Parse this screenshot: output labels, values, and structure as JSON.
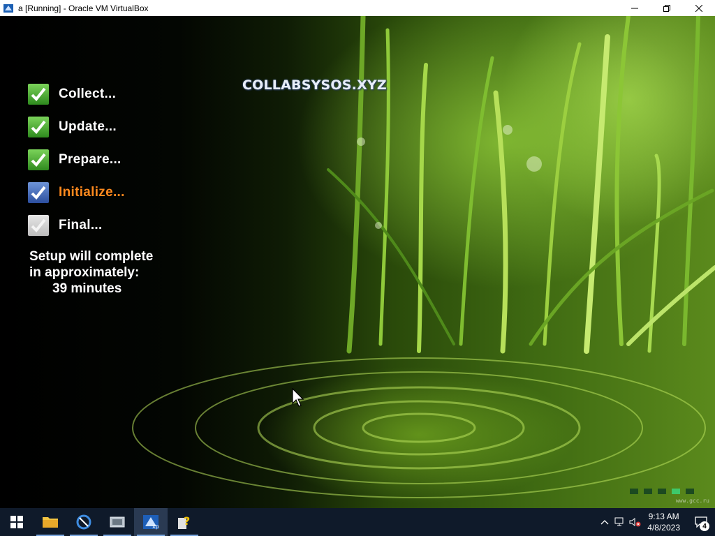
{
  "window": {
    "title": "a [Running] - Oracle VM VirtualBox",
    "controls": [
      "minimize",
      "restore",
      "close"
    ]
  },
  "setup": {
    "steps": [
      {
        "label": "Collect...",
        "state": "done"
      },
      {
        "label": "Update...",
        "state": "done"
      },
      {
        "label": "Prepare...",
        "state": "done"
      },
      {
        "label": "Initialize...",
        "state": "active"
      },
      {
        "label": "Final...",
        "state": "pending"
      }
    ],
    "estimate_line1": "Setup will complete",
    "estimate_line2": "in approximately:",
    "estimate_minutes": "39 minutes",
    "brand_text": "COLLABSYSOS.XYZ",
    "watermark": "www.gcc.ru",
    "progress_dots_active_index": 3
  },
  "taskbar": {
    "apps": [
      {
        "name": "start",
        "icon": "windows-logo-icon"
      },
      {
        "name": "file-explorer",
        "icon": "folder-icon"
      },
      {
        "name": "app-2",
        "icon": "app-blue-icon"
      },
      {
        "name": "app-3",
        "icon": "app-grey-icon"
      },
      {
        "name": "virtualbox-xp",
        "icon": "virtualbox-icon"
      },
      {
        "name": "app-5",
        "icon": "help-file-icon"
      }
    ],
    "time": "9:13 AM",
    "date": "4/8/2023",
    "notification_count": "4"
  },
  "colors": {
    "active_step": "#ff8a1e",
    "done_check": "#4cb83a",
    "active_check": "#3d66bb",
    "taskbar": "#0f1a2a"
  }
}
